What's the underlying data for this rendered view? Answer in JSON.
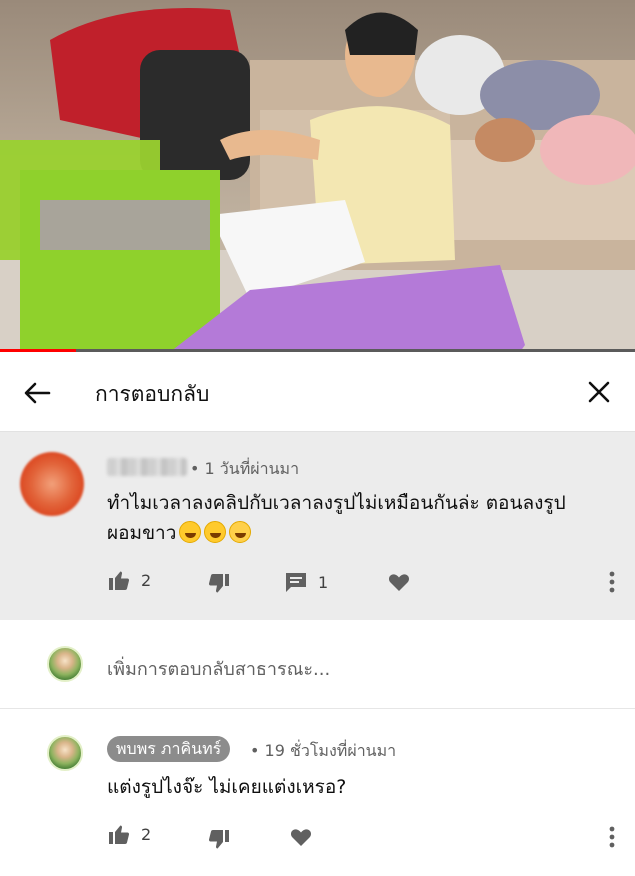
{
  "video": {
    "progress_fraction": 0.12,
    "progress_color": "#ff0000"
  },
  "header": {
    "title": "การตอบกลับ",
    "back_icon": "arrow-left-icon",
    "close_icon": "close-icon"
  },
  "main_comment": {
    "author_blurred": true,
    "time": "• 1 วันที่ผ่านมา",
    "text_line1": "ทำไมเวลาลงคลิปกับเวลาลงรูปไม่เหมือนกันล่ะ ตอนลงรูป",
    "text_line2": "ผอมขาว",
    "emojis": [
      "grinning-face",
      "grinning-face",
      "smiling-face"
    ],
    "likes": "2",
    "replies": "1"
  },
  "add_reply": {
    "placeholder": "เพิ่มการตอบกลับสาธารณะ..."
  },
  "reply": {
    "author": "พบพร ภาคินทร์",
    "time": "• 19 ชั่วโมงที่ผ่านมา",
    "text": "แต่งรูปไงจ๊ะ ไม่เคยแต่งเหรอ?",
    "likes": "2"
  }
}
